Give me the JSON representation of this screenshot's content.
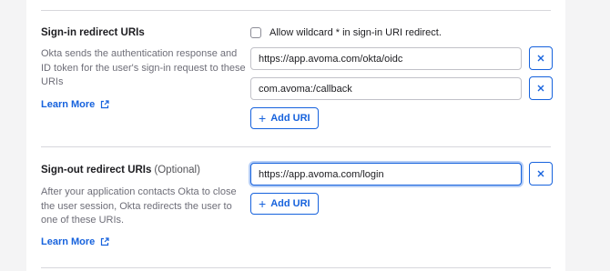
{
  "signin": {
    "title": "Sign-in redirect URIs",
    "description": "Okta sends the authentication response and ID token for the user's sign-in request to these URIs",
    "learn_more": "Learn More",
    "wildcard_label": "Allow wildcard * in sign-in URI redirect.",
    "wildcard_checked": false,
    "uris": [
      "https://app.avoma.com/okta/oidc",
      "com.avoma:/callback"
    ],
    "add_label": "Add URI"
  },
  "signout": {
    "title": "Sign-out redirect URIs",
    "optional": "(Optional)",
    "description": "After your application contacts Okta to close the user session, Okta redirects the user to one of these URIs.",
    "learn_more": "Learn More",
    "uris": [
      "https://app.avoma.com/login"
    ],
    "add_label": "Add URI"
  },
  "colors": {
    "accent": "#1662dd",
    "page_bg": "#f4f4f5",
    "card_bg": "#ffffff",
    "divider": "#d7d7dc"
  },
  "icons": {
    "external_link": "external-link-icon",
    "remove": "close-icon",
    "add": "plus-icon"
  }
}
